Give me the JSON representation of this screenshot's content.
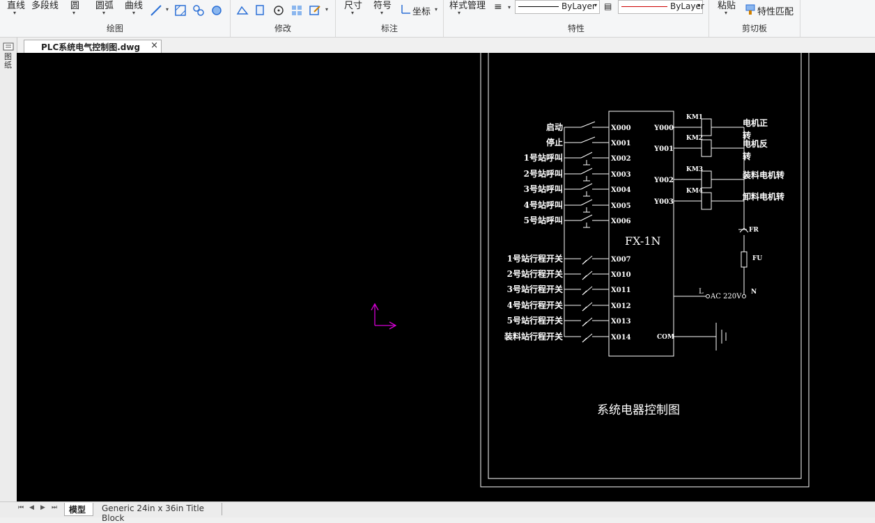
{
  "ribbon": {
    "draw": {
      "label": "绘图",
      "buttons": [
        "直线",
        "多段线",
        "圆",
        "圆弧",
        "曲线"
      ]
    },
    "modify": {
      "label": "修改"
    },
    "annotate": {
      "label": "标注",
      "buttons": [
        "尺寸",
        "符号",
        "坐标"
      ]
    },
    "properties": {
      "label": "特性",
      "style_manager": "样式管理",
      "linetype_value": "ByLayer",
      "color_value": "ByLayer"
    },
    "clipboard": {
      "label": "剪切板",
      "paste": "粘贴",
      "match_properties": "特性匹配"
    }
  },
  "document": {
    "tab_title": "PLC系统电气控制图.dwg",
    "close_glyph": "×"
  },
  "left_strip_label": "图纸",
  "layout_tabs": {
    "nav_glyphs": [
      "⏮",
      "◀",
      "▶",
      "⏭"
    ],
    "tabs": [
      "模型",
      "Generic 24in x 36in Title Block"
    ]
  },
  "drawing": {
    "plc_model": "FX-1N",
    "title": "系统电器控制图",
    "input_labels": [
      "启动",
      "停止",
      "1号站呼叫",
      "2号站呼叫",
      "3号站呼叫",
      "4号站呼叫",
      "5号站呼叫",
      "1号站行程开关",
      "2号站行程开关",
      "3号站行程开关",
      "4号站行程开关",
      "5号站行程开关",
      "装料站行程开关"
    ],
    "input_pins": [
      "X000",
      "X001",
      "X002",
      "X003",
      "X004",
      "X005",
      "X006",
      "X007",
      "X010",
      "X011",
      "X012",
      "X013",
      "X014"
    ],
    "output_pins": [
      "Y000",
      "Y001",
      "Y002",
      "Y003"
    ],
    "relays": [
      "KM1",
      "KM2",
      "KM3",
      "KM4"
    ],
    "output_labels_line1": [
      "电机正",
      "电机反",
      "装料电机转",
      "卸料电机转"
    ],
    "output_labels_line2": [
      "转",
      "转",
      "",
      ""
    ],
    "fr": "FR",
    "fu": "FU",
    "l": "L",
    "n": "N",
    "ac": "AC 220V",
    "com": "COM"
  },
  "colors": {
    "canvas_bg": "#000000",
    "line": "#ffffff",
    "ucs_icon": "#d400d4",
    "color_line": "#cc0000"
  }
}
